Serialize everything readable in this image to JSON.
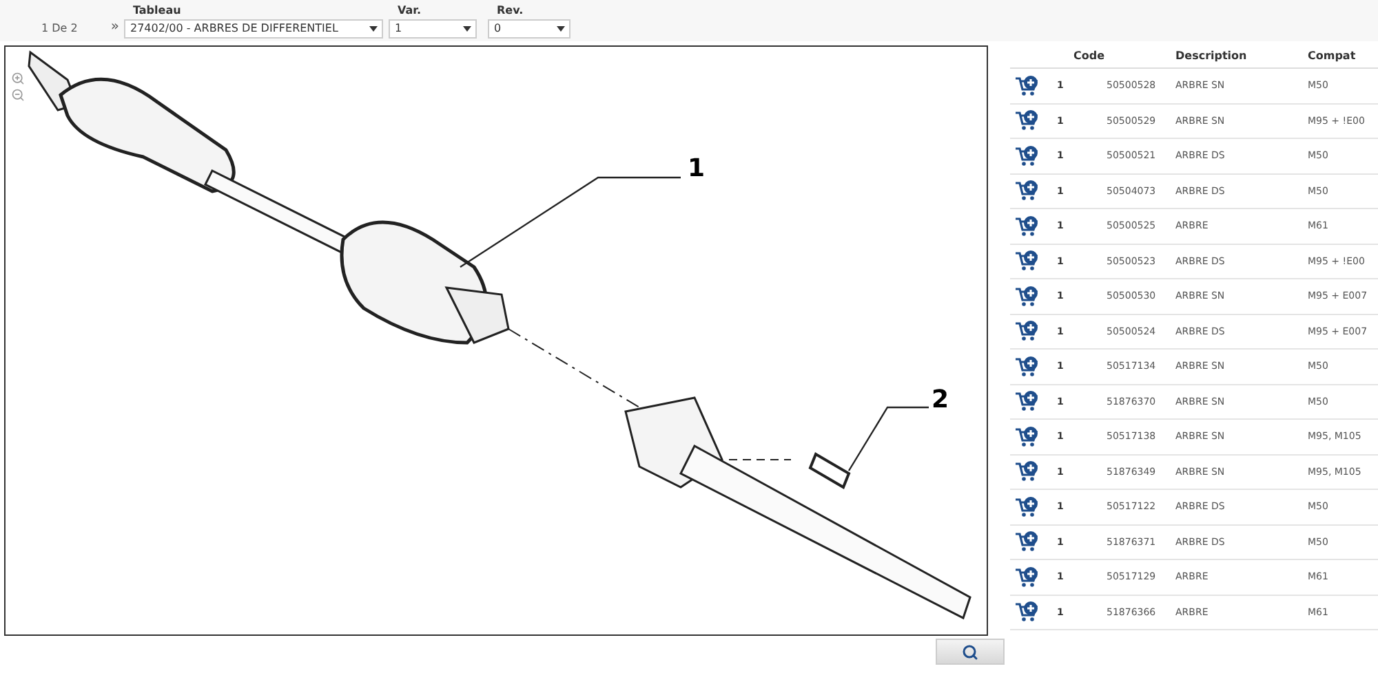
{
  "toolbar": {
    "page": "1 De 2",
    "next": "»",
    "fields": [
      {
        "label": "Tableau",
        "value": "27402/00 - ARBRES DE DIFFERENTIEL"
      },
      {
        "label": "Var.",
        "value": "1"
      },
      {
        "label": "Rev.",
        "value": "0"
      }
    ]
  },
  "diagram": {
    "callouts": [
      "1",
      "2"
    ]
  },
  "table": {
    "columns": [
      "Code",
      "Description",
      "Compat"
    ],
    "rows": [
      {
        "qty": "1",
        "code": "50500528",
        "description": "ARBRE SN",
        "compat": "M50"
      },
      {
        "qty": "1",
        "code": "50500529",
        "description": "ARBRE SN",
        "compat": "M95 + !E00"
      },
      {
        "qty": "1",
        "code": "50500521",
        "description": "ARBRE DS",
        "compat": "M50"
      },
      {
        "qty": "1",
        "code": "50504073",
        "description": "ARBRE DS",
        "compat": "M50"
      },
      {
        "qty": "1",
        "code": "50500525",
        "description": "ARBRE",
        "compat": "M61"
      },
      {
        "qty": "1",
        "code": "50500523",
        "description": "ARBRE DS",
        "compat": "M95 + !E00"
      },
      {
        "qty": "1",
        "code": "50500530",
        "description": "ARBRE SN",
        "compat": "M95 + E007"
      },
      {
        "qty": "1",
        "code": "50500524",
        "description": "ARBRE DS",
        "compat": "M95 + E007"
      },
      {
        "qty": "1",
        "code": "50517134",
        "description": "ARBRE SN",
        "compat": "M50"
      },
      {
        "qty": "1",
        "code": "51876370",
        "description": "ARBRE SN",
        "compat": "M50"
      },
      {
        "qty": "1",
        "code": "50517138",
        "description": "ARBRE SN",
        "compat": "M95, M105"
      },
      {
        "qty": "1",
        "code": "51876349",
        "description": "ARBRE SN",
        "compat": "M95, M105"
      },
      {
        "qty": "1",
        "code": "50517122",
        "description": "ARBRE DS",
        "compat": "M50"
      },
      {
        "qty": "1",
        "code": "51876371",
        "description": "ARBRE DS",
        "compat": "M50"
      },
      {
        "qty": "1",
        "code": "50517129",
        "description": "ARBRE",
        "compat": "M61"
      },
      {
        "qty": "1",
        "code": "51876366",
        "description": "ARBRE",
        "compat": "M61"
      }
    ]
  }
}
